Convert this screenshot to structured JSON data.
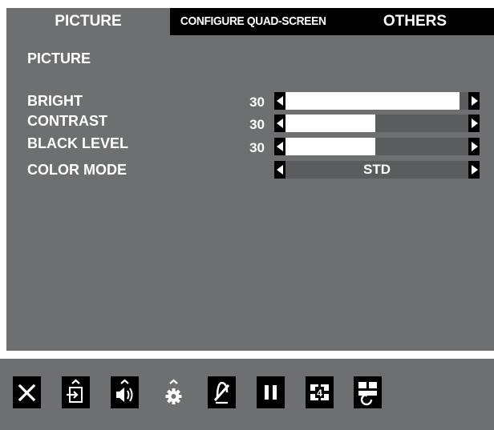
{
  "tabs": [
    {
      "label": "PICTURE",
      "active": true
    },
    {
      "label": "CONFIGURE QUAD-SCREEN",
      "active": false
    },
    {
      "label": "OTHERS",
      "active": false
    }
  ],
  "section_title": "PICTURE",
  "settings": [
    {
      "label": "BRIGHT",
      "value": "30",
      "level": 0.95
    },
    {
      "label": "CONTRAST",
      "value": "30",
      "level": 0.49
    },
    {
      "label": "BLACK LEVEL",
      "value": "30",
      "level": 0.49
    }
  ],
  "color_mode": {
    "label": "COLOR MODE",
    "value": "STD"
  },
  "toolbar_icons": [
    "close-icon",
    "input-select-icon",
    "volume-icon",
    "settings-icon",
    "mute-mic-icon",
    "pause-icon",
    "quad-4-icon",
    "layout-rotate-icon"
  ],
  "colors": {
    "panel": "#6e6f71",
    "tab_inactive": "#000000",
    "bar_fill": "#ffffff",
    "bar_track": "#5b5c5e"
  }
}
